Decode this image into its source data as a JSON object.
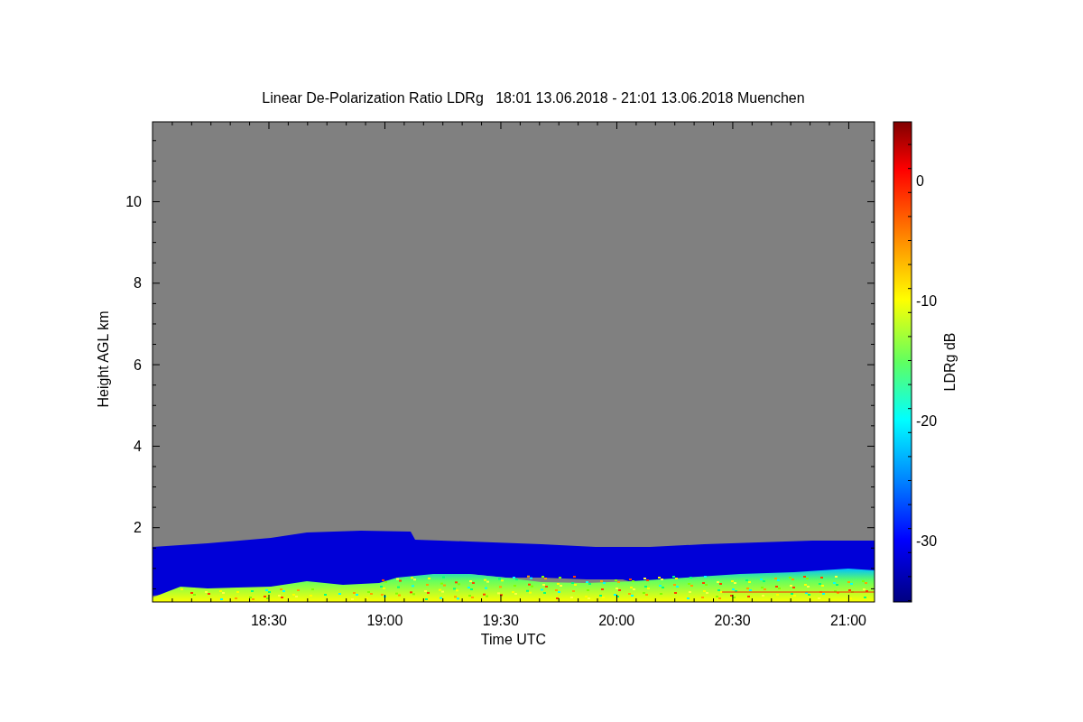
{
  "title": "Linear De-Polarization Ratio LDRg   18:01 13.06.2018 - 21:01 13.06.2018 Muenchen",
  "x_axis": {
    "label": "Time UTC",
    "ticks": [
      "18:30",
      "19:00",
      "19:30",
      "20:00",
      "20:30",
      "21:00"
    ]
  },
  "y_axis": {
    "label": "Height AGL km",
    "ticks": [
      "10",
      "8",
      "6",
      "4",
      "2"
    ]
  },
  "colorbar": {
    "label": "LDRg dB",
    "ticks": [
      "0",
      "-10",
      "-20",
      "-30"
    ]
  }
}
